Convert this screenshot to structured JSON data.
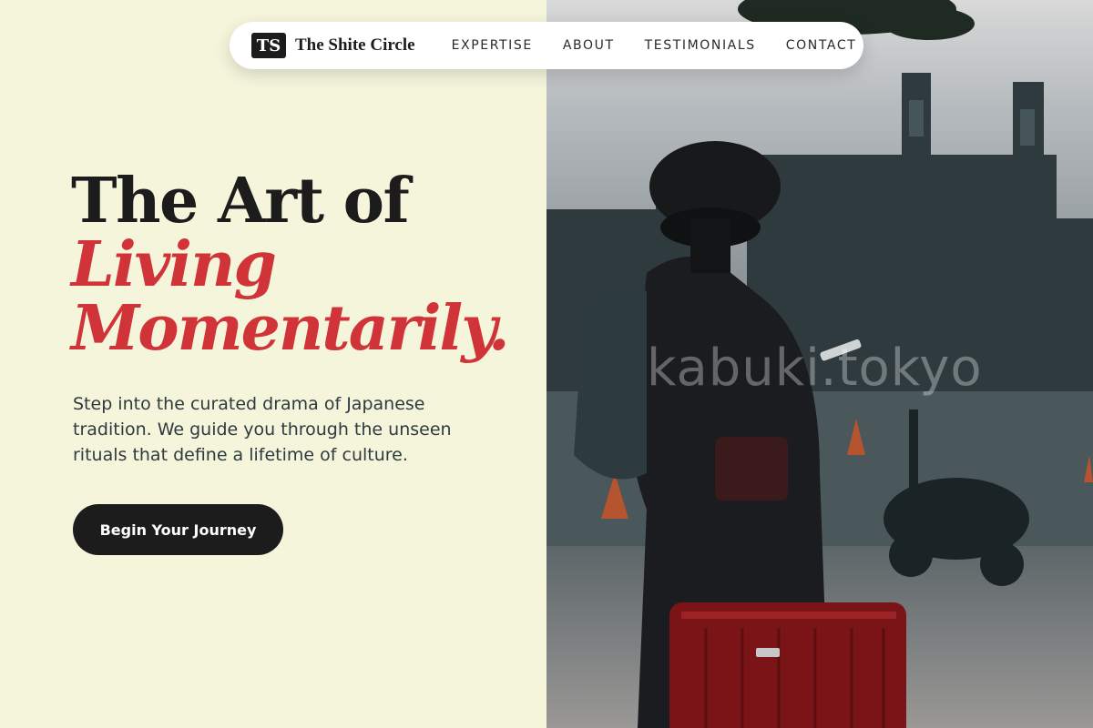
{
  "nav": {
    "logo_mark": "TS",
    "logo_text": "The Shite Circle",
    "links": [
      {
        "label": "EXPERTISE"
      },
      {
        "label": "ABOUT"
      },
      {
        "label": "TESTIMONIALS"
      },
      {
        "label": "CONTACT"
      }
    ]
  },
  "hero": {
    "title_line1": "The Art of",
    "title_line2": "Living",
    "title_line3": "Momentarily.",
    "description": "Step into the curated drama of Japanese tradition. We guide you through the unseen rituals that define a lifetime of culture.",
    "cta_label": "Begin Your Journey"
  },
  "photo": {
    "watermark": "kabuki.tokyo"
  },
  "colors": {
    "background": "#f5f5dc",
    "accent_red": "#d13438",
    "dark": "#1c1c1c"
  }
}
